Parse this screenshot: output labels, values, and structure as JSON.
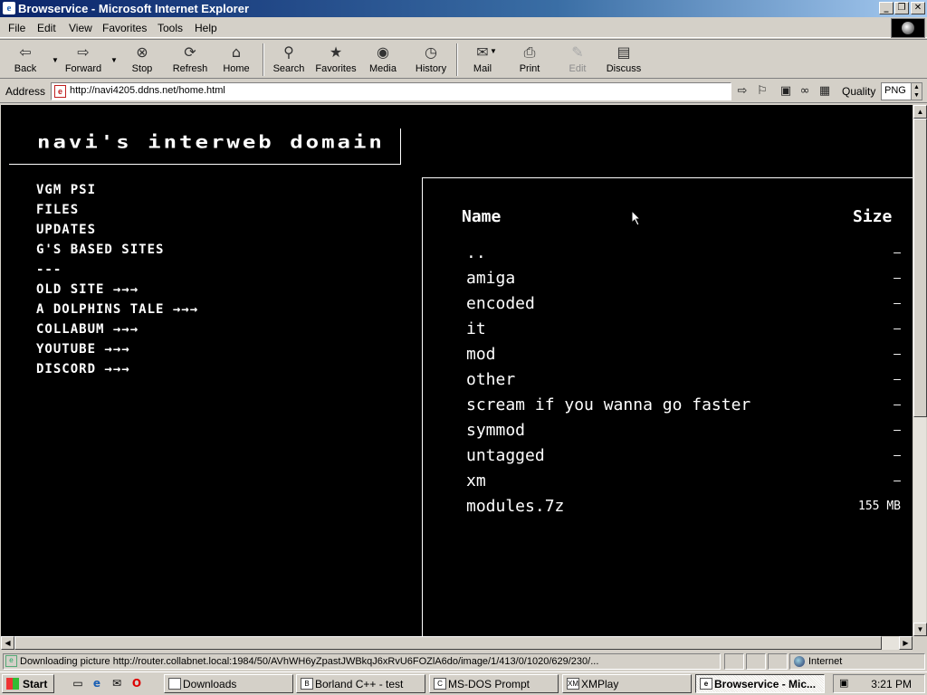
{
  "window": {
    "title": "Browservice - Microsoft Internet Explorer"
  },
  "menu": [
    "File",
    "Edit",
    "View",
    "Favorites",
    "Tools",
    "Help"
  ],
  "toolbar": {
    "back": "Back",
    "forward": "Forward",
    "stop": "Stop",
    "refresh": "Refresh",
    "home": "Home",
    "search": "Search",
    "favorites": "Favorites",
    "media": "Media",
    "history": "History",
    "mail": "Mail",
    "print": "Print",
    "edit": "Edit",
    "discuss": "Discuss"
  },
  "address": {
    "label": "Address",
    "url": "http://navi4205.ddns.net/home.html"
  },
  "quality": {
    "label": "Quality",
    "value": "PNG"
  },
  "page": {
    "site_title": "navi's interweb domain",
    "nav": [
      {
        "label": "VGM PSI"
      },
      {
        "label": "FILES"
      },
      {
        "label": "UPDATES"
      },
      {
        "label": "G'S BASED SITES"
      },
      {
        "label": "---"
      },
      {
        "label": "OLD SITE →→→"
      },
      {
        "label": "A DOLPHINS TALE →→→"
      },
      {
        "label": "COLLABUM →→→"
      },
      {
        "label": "YOUTUBE →→→"
      },
      {
        "label": "DISCORD →→→"
      }
    ],
    "listing": {
      "col_name": "Name",
      "col_size": "Size",
      "rows": [
        {
          "name": "..",
          "size": "–"
        },
        {
          "name": "amiga",
          "size": "–"
        },
        {
          "name": "encoded",
          "size": "–"
        },
        {
          "name": "it",
          "size": "–"
        },
        {
          "name": "mod",
          "size": "–"
        },
        {
          "name": "other",
          "size": "–"
        },
        {
          "name": "scream if you wanna go faster",
          "size": "–"
        },
        {
          "name": "symmod",
          "size": "–"
        },
        {
          "name": "untagged",
          "size": "–"
        },
        {
          "name": "xm",
          "size": "–"
        },
        {
          "name": "modules.7z",
          "size": "155 MB"
        }
      ]
    }
  },
  "status": {
    "text": "Downloading picture http://router.collabnet.local:1984/50/AVhWH6yZpastJWBkqJ6xRvU6FOZlA6do/image/1/413/0/1020/629/230/...",
    "zone": "Internet"
  },
  "taskbar": {
    "start": "Start",
    "tasks": [
      {
        "label": "Downloads"
      },
      {
        "label": "Borland C++ - test"
      },
      {
        "label": "MS-DOS Prompt"
      },
      {
        "label": "XMPlay"
      },
      {
        "label": "Browservice - Mic..."
      }
    ],
    "clock": "3:21 PM"
  }
}
